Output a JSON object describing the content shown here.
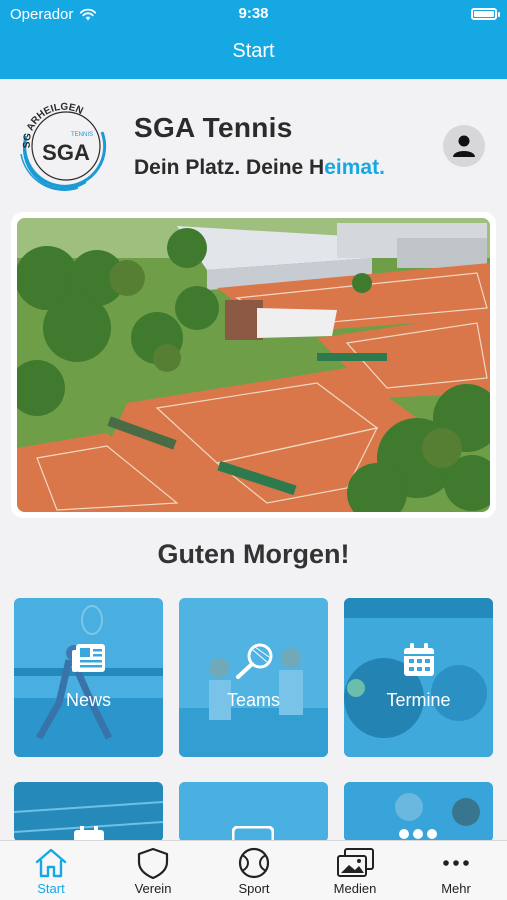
{
  "status_bar": {
    "carrier": "Operador",
    "time": "9:38",
    "wifi_icon": "wifi-icon",
    "battery_icon": "battery-icon"
  },
  "nav": {
    "title": "Start"
  },
  "club": {
    "logo_text_top": "SG ARHEILGEN",
    "logo_text_small": "TENNIS",
    "logo_text_main": "SGA",
    "name": "SGA Tennis",
    "tagline_part1": "Dein Platz. Deine H",
    "tagline_part2": "eimat.",
    "profile_icon": "person-icon"
  },
  "greeting": "Guten Morgen!",
  "tiles": [
    {
      "label": "News",
      "icon": "newspaper-icon"
    },
    {
      "label": "Teams",
      "icon": "tennis-racket-icon"
    },
    {
      "label": "Termine",
      "icon": "calendar-icon"
    }
  ],
  "tabs": [
    {
      "label": "Start",
      "icon": "home-icon",
      "active": true
    },
    {
      "label": "Verein",
      "icon": "shield-icon",
      "active": false
    },
    {
      "label": "Sport",
      "icon": "tennis-ball-icon",
      "active": false
    },
    {
      "label": "Medien",
      "icon": "gallery-icon",
      "active": false
    },
    {
      "label": "Mehr",
      "icon": "more-icon",
      "active": false
    }
  ],
  "colors": {
    "accent": "#15a8e3",
    "text": "#2b2b2b",
    "clay": "#d9774a",
    "background": "#f2f2f4"
  }
}
